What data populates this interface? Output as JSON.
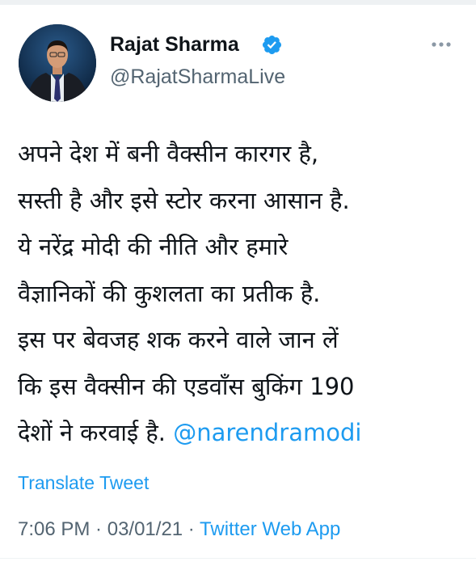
{
  "colors": {
    "text_primary": "#0f1419",
    "text_secondary": "#536471",
    "accent": "#1d9bf0"
  },
  "author": {
    "name": "Rajat Sharma",
    "handle": "@RajatSharmaLive",
    "verified_icon": "verified-badge-icon"
  },
  "more_icon": "more-horizontal-icon",
  "tweet": {
    "lines": [
      "अपने देश में बनी  वैक्सीन कारगर है,",
      "सस्ती है और इसे स्टोर करना आसान है.",
      "ये नरेंद्र मोदी  की नीति और हमारे",
      "वैज्ञानिकों की कुशलता का प्रतीक है.",
      "इस पर बेवजह शक करने वाले जान लें",
      "कि इस वैक्सीन की एडवॉंस बुकिंग 190",
      "देशों ने करवाई है."
    ],
    "mention": "@narendramodi"
  },
  "translate_label": "Translate Tweet",
  "meta": {
    "time": "7:06 PM",
    "separator": " · ",
    "date": "03/01/21",
    "source": "Twitter Web App"
  }
}
